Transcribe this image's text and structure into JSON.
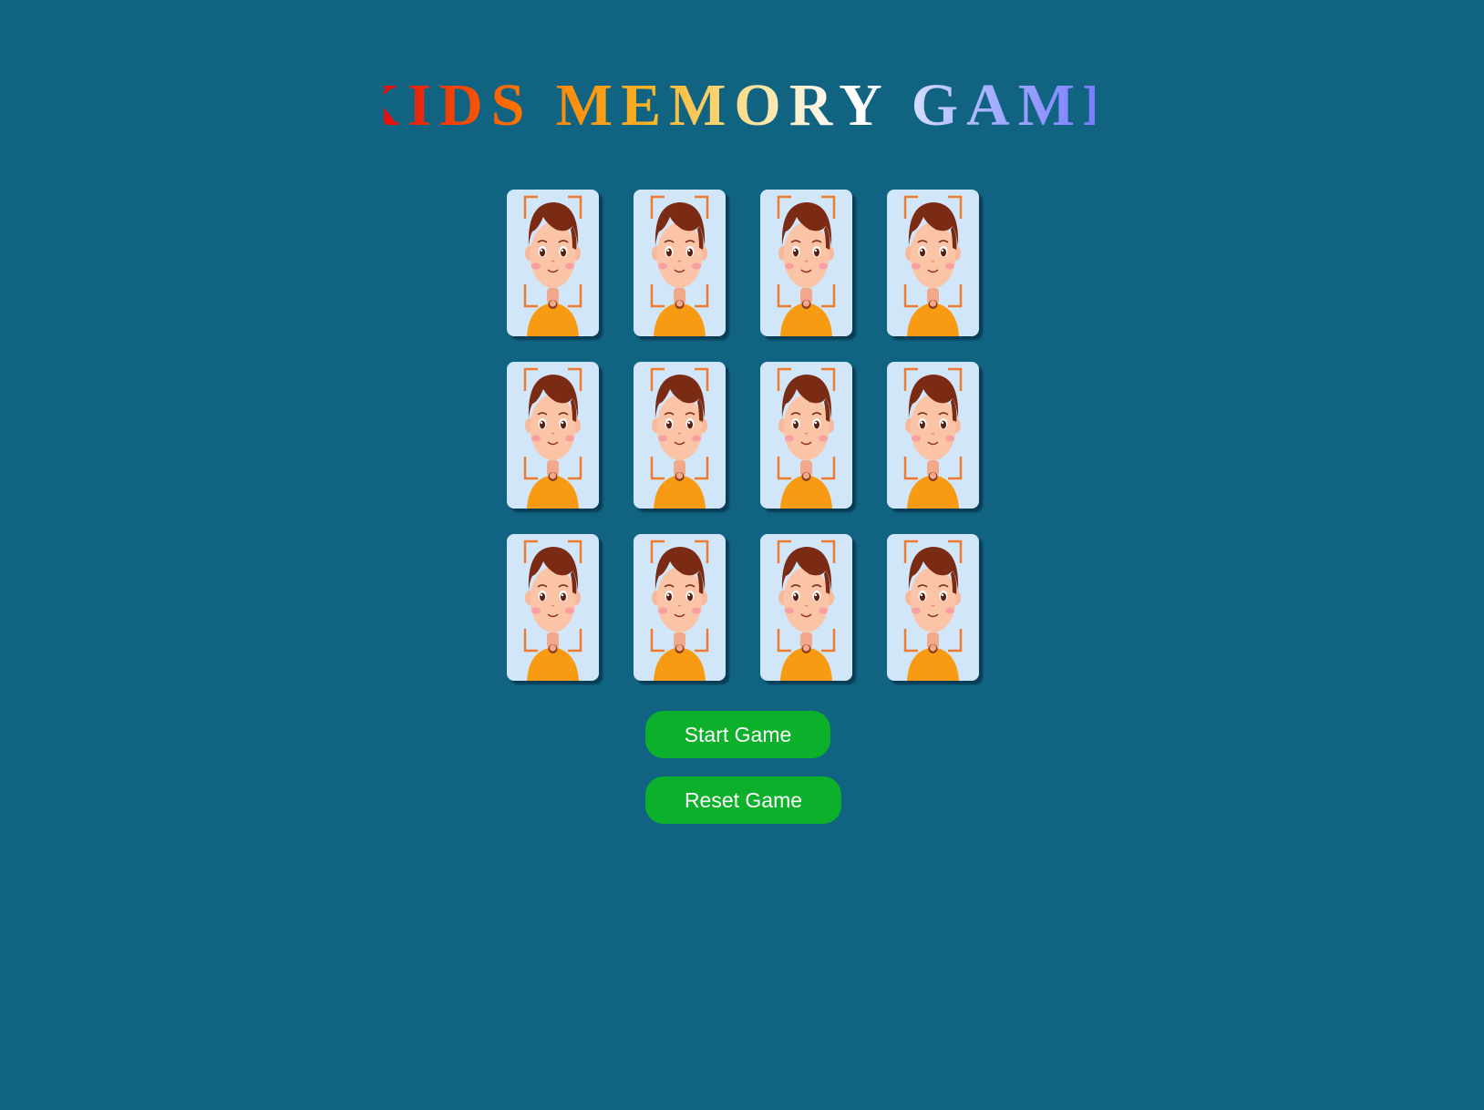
{
  "title": "KIDS MEMORY GAME",
  "colors": {
    "background": "#106482",
    "card_back": "#d2e6f9",
    "button": "#0db02b",
    "button_text": "#ffffff"
  },
  "board": {
    "rows": 3,
    "columns": 4,
    "card_back_icon": "kid-face-icon",
    "cards": [
      {
        "state": "face-down"
      },
      {
        "state": "face-down"
      },
      {
        "state": "face-down"
      },
      {
        "state": "face-down"
      },
      {
        "state": "face-down"
      },
      {
        "state": "face-down"
      },
      {
        "state": "face-down"
      },
      {
        "state": "face-down"
      },
      {
        "state": "face-down"
      },
      {
        "state": "face-down"
      },
      {
        "state": "face-down"
      },
      {
        "state": "face-down"
      }
    ]
  },
  "buttons": {
    "start_label": "Start Game",
    "reset_label": "Reset Game"
  }
}
